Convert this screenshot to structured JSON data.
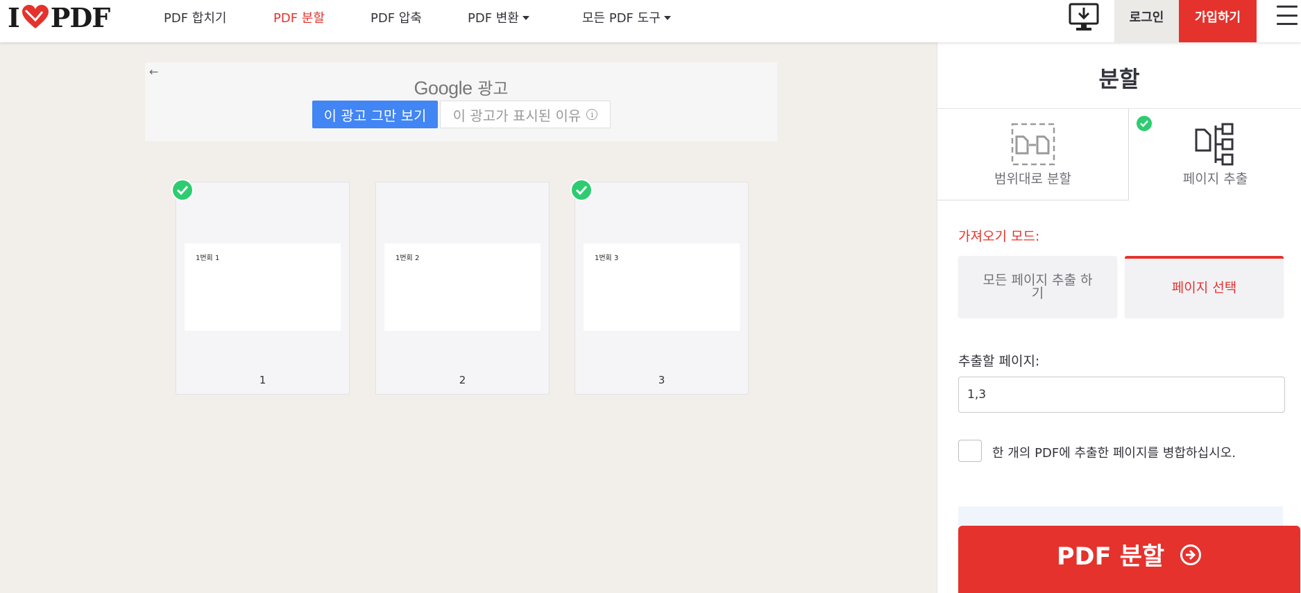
{
  "header": {
    "logo": {
      "prefix": "I",
      "suffix": "PDF"
    },
    "nav": [
      {
        "label": "PDF 합치기",
        "active": false,
        "dropdown": false
      },
      {
        "label": "PDF 분할",
        "active": true,
        "dropdown": false
      },
      {
        "label": "PDF 압축",
        "active": false,
        "dropdown": false
      },
      {
        "label": "PDF 변환",
        "active": false,
        "dropdown": true
      },
      {
        "label": "모든 PDF 도구",
        "active": false,
        "dropdown": true
      }
    ],
    "login_label": "로그인",
    "signup_label": "가입하기"
  },
  "ad": {
    "google_word": "Google",
    "ad_word": "광고",
    "stop_label": "이 광고 그만 보기",
    "why_label": "이 광고가 표시된 이유"
  },
  "pages": [
    {
      "thumb_text": "1번회 1",
      "number": "1",
      "selected": true
    },
    {
      "thumb_text": "1번회 2",
      "number": "2",
      "selected": false
    },
    {
      "thumb_text": "1번회 3",
      "number": "3",
      "selected": true
    }
  ],
  "sidebar": {
    "title": "분할",
    "modes": [
      {
        "label": "범위대로 분할",
        "selected": false
      },
      {
        "label": "페이지 추출",
        "selected": true
      }
    ],
    "import_mode_label": "가져오기 모드:",
    "options": [
      {
        "label": "모든 페이지 추출 하기",
        "selected": false
      },
      {
        "label": "페이지 선택",
        "selected": true
      }
    ],
    "extract_label": "추출할 페이지:",
    "extract_value": "1,3",
    "merge_label": "한 개의 PDF에 추출한 페이지를 병합하십시오.",
    "merge_checked": false,
    "split_button": "PDF 분할"
  },
  "colors": {
    "brand_red": "#e5322d",
    "ad_blue": "#4285f4",
    "check_green": "#2ecc71",
    "canvas_bg": "#f2efeb"
  }
}
